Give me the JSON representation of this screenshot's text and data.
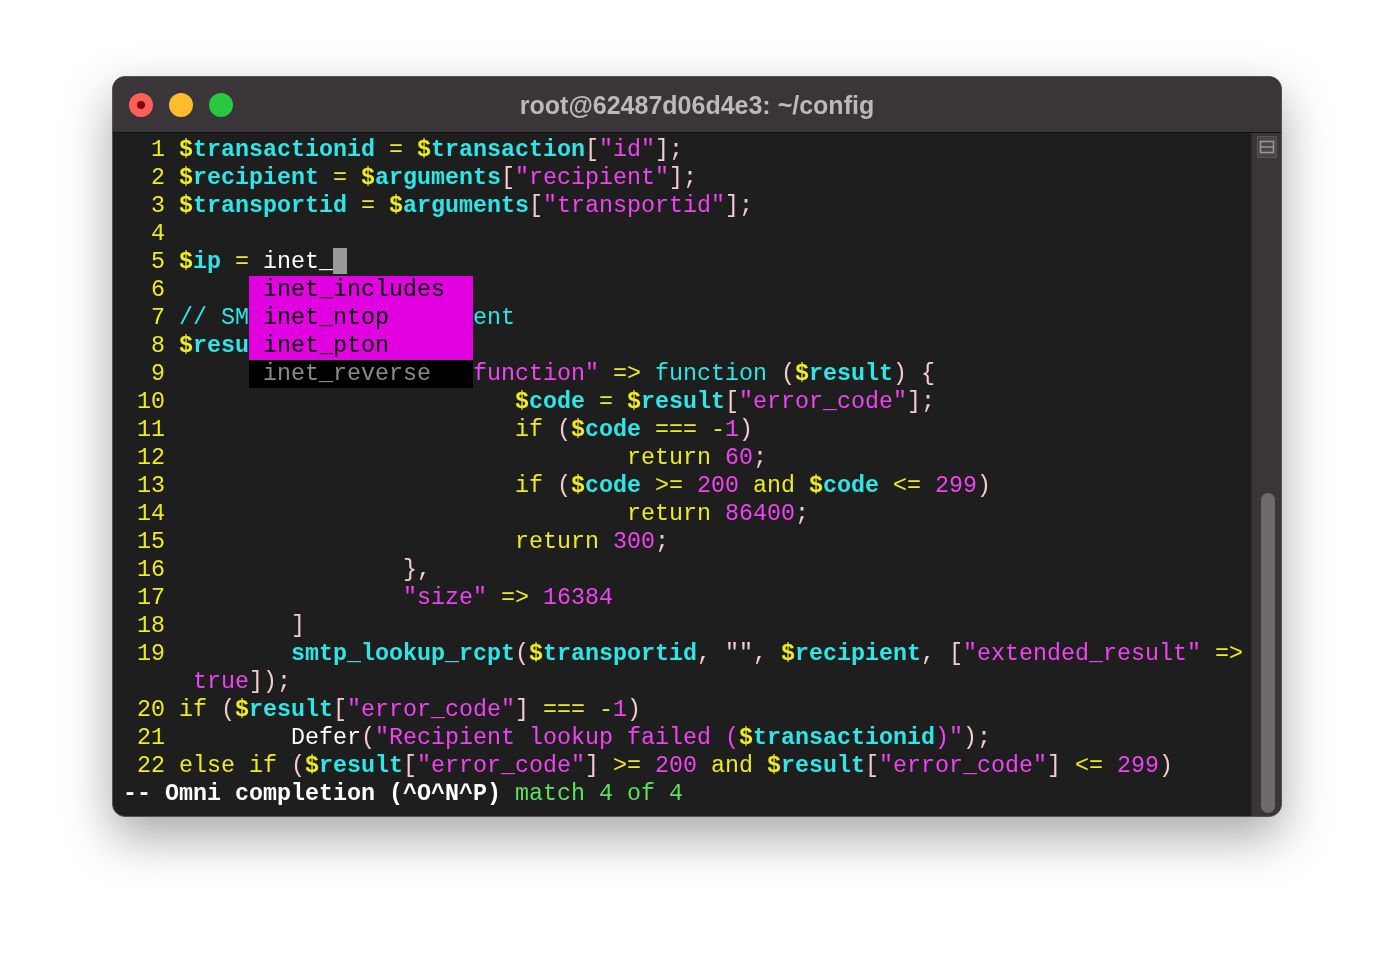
{
  "window": {
    "title": "root@62487d06d4e3: ~/config"
  },
  "lines": [
    {
      "number": "1",
      "chunks": [
        [
          {
            "text": "$",
            "kind": "sigil"
          },
          {
            "text": "transactionid",
            "kind": "var"
          },
          {
            "text": " = ",
            "kind": "op"
          },
          {
            "text": "$",
            "kind": "sigil"
          },
          {
            "text": "transaction",
            "kind": "var"
          },
          {
            "text": "[",
            "kind": "punct"
          },
          {
            "text": "\"id\"",
            "kind": "str"
          },
          {
            "text": "];",
            "kind": "punct"
          }
        ]
      ]
    },
    {
      "number": "2",
      "chunks": [
        [
          {
            "text": "$",
            "kind": "sigil"
          },
          {
            "text": "recipient",
            "kind": "var"
          },
          {
            "text": " = ",
            "kind": "op"
          },
          {
            "text": "$",
            "kind": "sigil"
          },
          {
            "text": "arguments",
            "kind": "var"
          },
          {
            "text": "[",
            "kind": "punct"
          },
          {
            "text": "\"recipient\"",
            "kind": "str"
          },
          {
            "text": "];",
            "kind": "punct"
          }
        ]
      ]
    },
    {
      "number": "3",
      "chunks": [
        [
          {
            "text": "$",
            "kind": "sigil"
          },
          {
            "text": "transportid",
            "kind": "var"
          },
          {
            "text": " = ",
            "kind": "op"
          },
          {
            "text": "$",
            "kind": "sigil"
          },
          {
            "text": "arguments",
            "kind": "var"
          },
          {
            "text": "[",
            "kind": "punct"
          },
          {
            "text": "\"transportid\"",
            "kind": "str"
          },
          {
            "text": "];",
            "kind": "punct"
          }
        ]
      ]
    },
    {
      "number": "4"
    },
    {
      "number": "5",
      "cursor": true,
      "chunks": [
        [
          {
            "text": "$",
            "kind": "sigil"
          },
          {
            "text": "ip",
            "kind": "var"
          },
          {
            "text": " = ",
            "kind": "op"
          },
          {
            "text": "inet_",
            "kind": "plain"
          }
        ]
      ]
    },
    {
      "number": "6"
    },
    {
      "number": "7",
      "chunks": [
        [
          {
            "text": "// SM",
            "kind": "comment"
          }
        ],
        [
          {
            "text": "                ent",
            "kind": "comment"
          }
        ]
      ]
    },
    {
      "number": "8",
      "chunks": [
        [
          {
            "text": "$",
            "kind": "sigil"
          },
          {
            "text": "resu",
            "kind": "var"
          }
        ]
      ]
    },
    {
      "number": "9",
      "chunks": [
        [
          {
            "text": "                     function\"",
            "kind": "str"
          },
          {
            "text": " => ",
            "kind": "op"
          },
          {
            "text": "function",
            "kind": "fn"
          },
          {
            "text": " (",
            "kind": "punct"
          },
          {
            "text": "$",
            "kind": "sigil"
          },
          {
            "text": "result",
            "kind": "var"
          },
          {
            "text": ") {",
            "kind": "punct"
          }
        ]
      ]
    },
    {
      "number": "10",
      "chunks": [
        [
          {
            "text": "                        $",
            "kind": "sigil"
          },
          {
            "text": "code",
            "kind": "var"
          },
          {
            "text": " = ",
            "kind": "op"
          },
          {
            "text": "$",
            "kind": "sigil"
          },
          {
            "text": "result",
            "kind": "var"
          },
          {
            "text": "[",
            "kind": "punct"
          },
          {
            "text": "\"error_code\"",
            "kind": "str"
          },
          {
            "text": "];",
            "kind": "punct"
          }
        ]
      ]
    },
    {
      "number": "11",
      "chunks": [
        [
          {
            "text": "                        if",
            "kind": "kw"
          },
          {
            "text": " (",
            "kind": "punct"
          },
          {
            "text": "$",
            "kind": "sigil"
          },
          {
            "text": "code",
            "kind": "var"
          },
          {
            "text": " === -",
            "kind": "op"
          },
          {
            "text": "1",
            "kind": "num"
          },
          {
            "text": ")",
            "kind": "punct"
          }
        ]
      ]
    },
    {
      "number": "12",
      "chunks": [
        [
          {
            "text": "                                return",
            "kind": "kw"
          },
          {
            "text": " 60",
            "kind": "num"
          },
          {
            "text": ";",
            "kind": "punct"
          }
        ]
      ]
    },
    {
      "number": "13",
      "chunks": [
        [
          {
            "text": "                        if",
            "kind": "kw"
          },
          {
            "text": " (",
            "kind": "punct"
          },
          {
            "text": "$",
            "kind": "sigil"
          },
          {
            "text": "code",
            "kind": "var"
          },
          {
            "text": " >= ",
            "kind": "op"
          },
          {
            "text": "200",
            "kind": "num"
          },
          {
            "text": " and ",
            "kind": "kw"
          },
          {
            "text": "$",
            "kind": "sigil"
          },
          {
            "text": "code",
            "kind": "var"
          },
          {
            "text": " <= ",
            "kind": "op"
          },
          {
            "text": "299",
            "kind": "num"
          },
          {
            "text": ")",
            "kind": "punct"
          }
        ]
      ]
    },
    {
      "number": "14",
      "chunks": [
        [
          {
            "text": "                                return",
            "kind": "kw"
          },
          {
            "text": " 86400",
            "kind": "num"
          },
          {
            "text": ";",
            "kind": "punct"
          }
        ]
      ]
    },
    {
      "number": "15",
      "chunks": [
        [
          {
            "text": "                        return",
            "kind": "kw"
          },
          {
            "text": " 300",
            "kind": "num"
          },
          {
            "text": ";",
            "kind": "punct"
          }
        ]
      ]
    },
    {
      "number": "16",
      "chunks": [
        [
          {
            "text": "                },",
            "kind": "punct"
          }
        ]
      ]
    },
    {
      "number": "17",
      "chunks": [
        [
          {
            "text": "                \"size\"",
            "kind": "str"
          },
          {
            "text": " => ",
            "kind": "op"
          },
          {
            "text": "16384",
            "kind": "num"
          }
        ]
      ]
    },
    {
      "number": "18",
      "chunks": [
        [
          {
            "text": "        ]",
            "kind": "punct"
          }
        ]
      ]
    },
    {
      "number": "19",
      "chunks": [
        [
          {
            "text": "        smtp_lookup_rcpt",
            "kind": "func"
          },
          {
            "text": "(",
            "kind": "punct"
          },
          {
            "text": "$",
            "kind": "sigil"
          },
          {
            "text": "transportid",
            "kind": "var"
          },
          {
            "text": ", \"\", ",
            "kind": "punct"
          },
          {
            "text": "$",
            "kind": "sigil"
          },
          {
            "text": "recipient",
            "kind": "var"
          },
          {
            "text": ", [",
            "kind": "punct"
          },
          {
            "text": "\"extended_result\"",
            "kind": "str"
          },
          {
            "text": " =>",
            "kind": "op"
          }
        ]
      ]
    },
    {
      "chunks": [
        [
          {
            "text": " true",
            "kind": "num"
          },
          {
            "text": "]);",
            "kind": "punct"
          }
        ]
      ]
    },
    {
      "number": "20",
      "chunks": [
        [
          {
            "text": "if",
            "kind": "kw"
          },
          {
            "text": " (",
            "kind": "punct"
          },
          {
            "text": "$",
            "kind": "sigil"
          },
          {
            "text": "result",
            "kind": "var"
          },
          {
            "text": "[",
            "kind": "punct"
          },
          {
            "text": "\"error_code\"",
            "kind": "str"
          },
          {
            "text": "]",
            "kind": "punct"
          },
          {
            "text": " === -",
            "kind": "op"
          },
          {
            "text": "1",
            "kind": "num"
          },
          {
            "text": ")",
            "kind": "punct"
          }
        ]
      ]
    },
    {
      "number": "21",
      "chunks": [
        [
          {
            "text": "        Defer",
            "kind": "plain"
          },
          {
            "text": "(",
            "kind": "punct"
          },
          {
            "text": "\"Recipient lookup failed (",
            "kind": "str"
          },
          {
            "text": "$",
            "kind": "sigil"
          },
          {
            "text": "transactionid",
            "kind": "var"
          },
          {
            "text": ")\"",
            "kind": "str"
          },
          {
            "text": ");",
            "kind": "punct"
          }
        ]
      ]
    },
    {
      "number": "22",
      "chunks": [
        [
          {
            "text": "else if",
            "kind": "kw"
          },
          {
            "text": " (",
            "kind": "punct"
          },
          {
            "text": "$",
            "kind": "sigil"
          },
          {
            "text": "result",
            "kind": "var"
          },
          {
            "text": "[",
            "kind": "punct"
          },
          {
            "text": "\"error_code\"",
            "kind": "str"
          },
          {
            "text": "]",
            "kind": "punct"
          },
          {
            "text": " >= ",
            "kind": "op"
          },
          {
            "text": "200",
            "kind": "num"
          },
          {
            "text": " and ",
            "kind": "kw"
          },
          {
            "text": "$",
            "kind": "sigil"
          },
          {
            "text": "result",
            "kind": "var"
          },
          {
            "text": "[",
            "kind": "punct"
          },
          {
            "text": "\"error_code\"",
            "kind": "str"
          },
          {
            "text": "]",
            "kind": "punct"
          },
          {
            "text": " <= ",
            "kind": "op"
          },
          {
            "text": "299",
            "kind": "num"
          },
          {
            "text": ")",
            "kind": "punct"
          }
        ]
      ]
    }
  ],
  "completion_menu": {
    "items": [
      {
        "label": "inet_includes",
        "selected": false
      },
      {
        "label": "inet_ntop",
        "selected": false
      },
      {
        "label": "inet_pton",
        "selected": false
      },
      {
        "label": "inet_reverse",
        "selected": true
      }
    ]
  },
  "status_line": [
    {
      "text": "-- Omni completion (^O^N^P)",
      "kind": "mode"
    },
    {
      "text": " match 4 of 4",
      "kind": "msg"
    }
  ]
}
